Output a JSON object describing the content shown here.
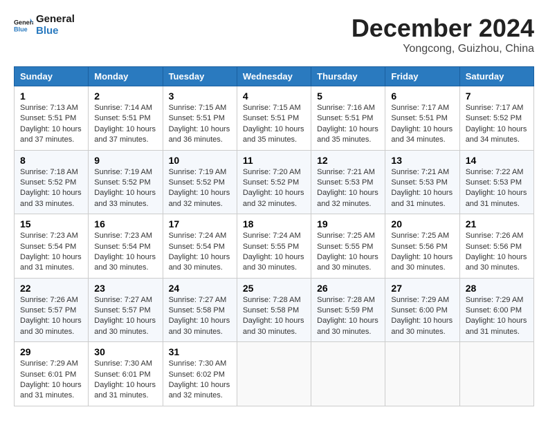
{
  "header": {
    "logo_general": "General",
    "logo_blue": "Blue",
    "month": "December 2024",
    "location": "Yongcong, Guizhou, China"
  },
  "weekdays": [
    "Sunday",
    "Monday",
    "Tuesday",
    "Wednesday",
    "Thursday",
    "Friday",
    "Saturday"
  ],
  "weeks": [
    [
      {
        "day": "1",
        "sunrise": "7:13 AM",
        "sunset": "5:51 PM",
        "daylight": "10 hours and 37 minutes."
      },
      {
        "day": "2",
        "sunrise": "7:14 AM",
        "sunset": "5:51 PM",
        "daylight": "10 hours and 37 minutes."
      },
      {
        "day": "3",
        "sunrise": "7:15 AM",
        "sunset": "5:51 PM",
        "daylight": "10 hours and 36 minutes."
      },
      {
        "day": "4",
        "sunrise": "7:15 AM",
        "sunset": "5:51 PM",
        "daylight": "10 hours and 35 minutes."
      },
      {
        "day": "5",
        "sunrise": "7:16 AM",
        "sunset": "5:51 PM",
        "daylight": "10 hours and 35 minutes."
      },
      {
        "day": "6",
        "sunrise": "7:17 AM",
        "sunset": "5:51 PM",
        "daylight": "10 hours and 34 minutes."
      },
      {
        "day": "7",
        "sunrise": "7:17 AM",
        "sunset": "5:52 PM",
        "daylight": "10 hours and 34 minutes."
      }
    ],
    [
      {
        "day": "8",
        "sunrise": "7:18 AM",
        "sunset": "5:52 PM",
        "daylight": "10 hours and 33 minutes."
      },
      {
        "day": "9",
        "sunrise": "7:19 AM",
        "sunset": "5:52 PM",
        "daylight": "10 hours and 33 minutes."
      },
      {
        "day": "10",
        "sunrise": "7:19 AM",
        "sunset": "5:52 PM",
        "daylight": "10 hours and 32 minutes."
      },
      {
        "day": "11",
        "sunrise": "7:20 AM",
        "sunset": "5:52 PM",
        "daylight": "10 hours and 32 minutes."
      },
      {
        "day": "12",
        "sunrise": "7:21 AM",
        "sunset": "5:53 PM",
        "daylight": "10 hours and 32 minutes."
      },
      {
        "day": "13",
        "sunrise": "7:21 AM",
        "sunset": "5:53 PM",
        "daylight": "10 hours and 31 minutes."
      },
      {
        "day": "14",
        "sunrise": "7:22 AM",
        "sunset": "5:53 PM",
        "daylight": "10 hours and 31 minutes."
      }
    ],
    [
      {
        "day": "15",
        "sunrise": "7:23 AM",
        "sunset": "5:54 PM",
        "daylight": "10 hours and 31 minutes."
      },
      {
        "day": "16",
        "sunrise": "7:23 AM",
        "sunset": "5:54 PM",
        "daylight": "10 hours and 30 minutes."
      },
      {
        "day": "17",
        "sunrise": "7:24 AM",
        "sunset": "5:54 PM",
        "daylight": "10 hours and 30 minutes."
      },
      {
        "day": "18",
        "sunrise": "7:24 AM",
        "sunset": "5:55 PM",
        "daylight": "10 hours and 30 minutes."
      },
      {
        "day": "19",
        "sunrise": "7:25 AM",
        "sunset": "5:55 PM",
        "daylight": "10 hours and 30 minutes."
      },
      {
        "day": "20",
        "sunrise": "7:25 AM",
        "sunset": "5:56 PM",
        "daylight": "10 hours and 30 minutes."
      },
      {
        "day": "21",
        "sunrise": "7:26 AM",
        "sunset": "5:56 PM",
        "daylight": "10 hours and 30 minutes."
      }
    ],
    [
      {
        "day": "22",
        "sunrise": "7:26 AM",
        "sunset": "5:57 PM",
        "daylight": "10 hours and 30 minutes."
      },
      {
        "day": "23",
        "sunrise": "7:27 AM",
        "sunset": "5:57 PM",
        "daylight": "10 hours and 30 minutes."
      },
      {
        "day": "24",
        "sunrise": "7:27 AM",
        "sunset": "5:58 PM",
        "daylight": "10 hours and 30 minutes."
      },
      {
        "day": "25",
        "sunrise": "7:28 AM",
        "sunset": "5:58 PM",
        "daylight": "10 hours and 30 minutes."
      },
      {
        "day": "26",
        "sunrise": "7:28 AM",
        "sunset": "5:59 PM",
        "daylight": "10 hours and 30 minutes."
      },
      {
        "day": "27",
        "sunrise": "7:29 AM",
        "sunset": "6:00 PM",
        "daylight": "10 hours and 30 minutes."
      },
      {
        "day": "28",
        "sunrise": "7:29 AM",
        "sunset": "6:00 PM",
        "daylight": "10 hours and 31 minutes."
      }
    ],
    [
      {
        "day": "29",
        "sunrise": "7:29 AM",
        "sunset": "6:01 PM",
        "daylight": "10 hours and 31 minutes."
      },
      {
        "day": "30",
        "sunrise": "7:30 AM",
        "sunset": "6:01 PM",
        "daylight": "10 hours and 31 minutes."
      },
      {
        "day": "31",
        "sunrise": "7:30 AM",
        "sunset": "6:02 PM",
        "daylight": "10 hours and 32 minutes."
      },
      null,
      null,
      null,
      null
    ]
  ]
}
